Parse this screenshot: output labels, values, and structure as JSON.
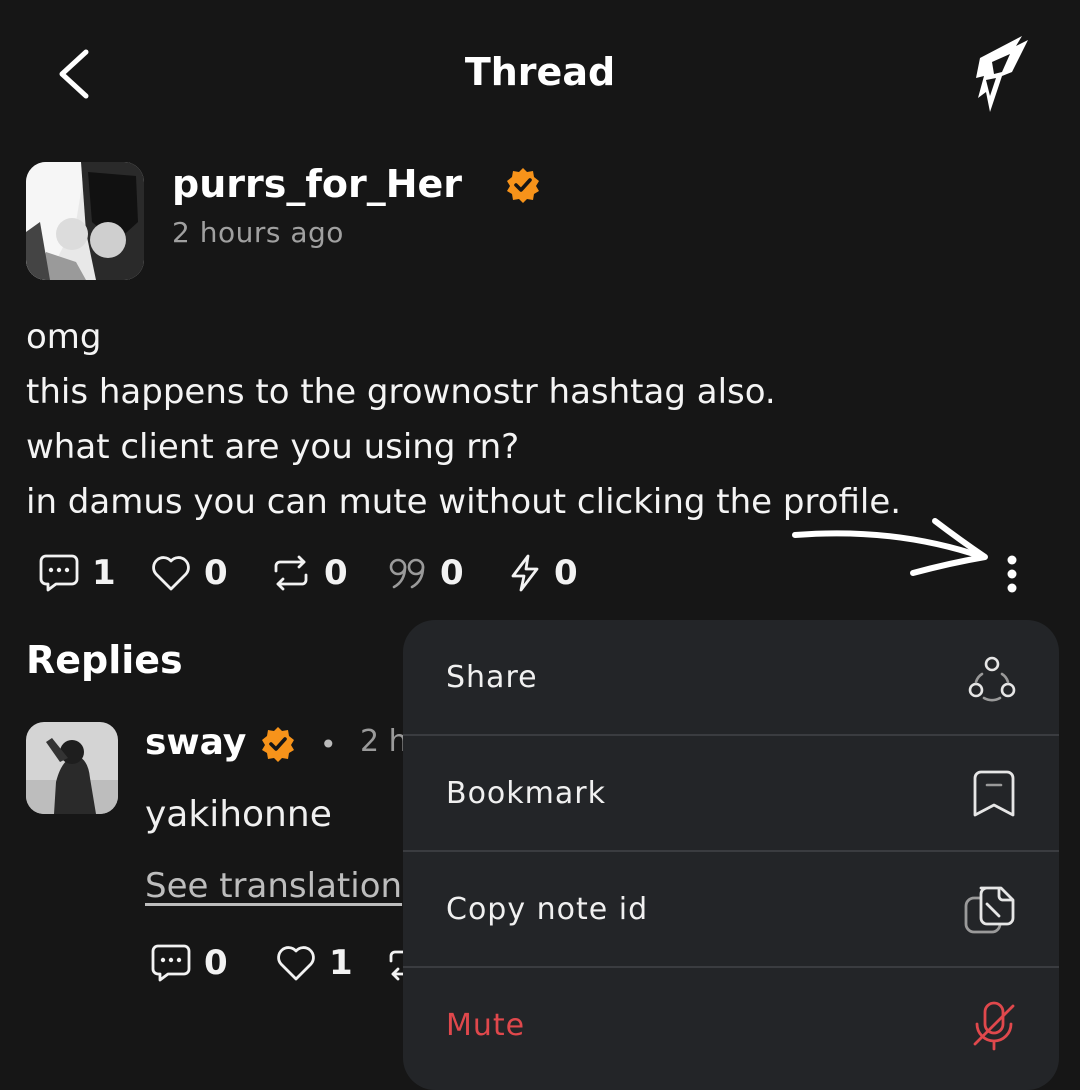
{
  "header": {
    "title": "Thread",
    "back_icon": "chevron-left-icon",
    "logo_icon": "app-logo-icon"
  },
  "post": {
    "author": "purrs_for_Her",
    "verified_color": "#f7931a",
    "time": "2 hours ago",
    "lines": [
      "omg",
      "this happens to the grownostr hashtag also.",
      "what client are you using rn?",
      "in damus you can mute without clicking the profile."
    ],
    "actions": {
      "comments": "1",
      "likes": "0",
      "reposts": "0",
      "quotes": "0",
      "zaps": "0"
    }
  },
  "replies": {
    "title": "Replies",
    "items": [
      {
        "author": "sway",
        "separator": "•",
        "time": "2 h",
        "body": "yakihonne",
        "translate_label": "See translation",
        "comments": "0",
        "likes": "1"
      }
    ]
  },
  "menu": {
    "items": [
      {
        "label": "Share",
        "icon": "share-icon"
      },
      {
        "label": "Bookmark",
        "icon": "bookmark-icon"
      },
      {
        "label": "Copy note id",
        "icon": "copy-icon"
      },
      {
        "label": "Mute",
        "icon": "mute-icon",
        "color": "#e0484c"
      }
    ]
  }
}
